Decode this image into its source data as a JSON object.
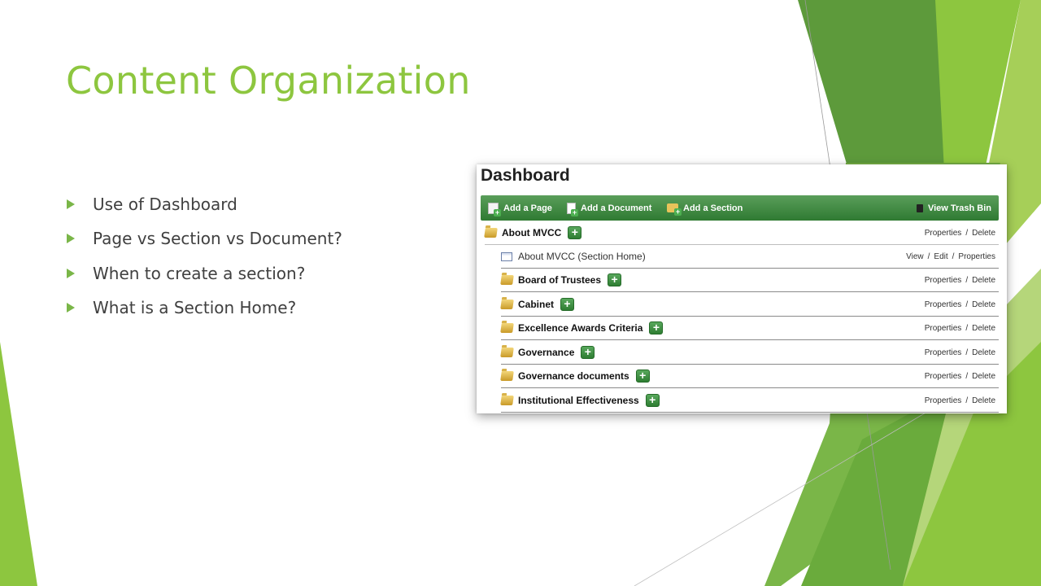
{
  "slide": {
    "title": "Content Organization",
    "bullets": [
      "Use of Dashboard",
      "Page vs Section vs Document?",
      "When to create a section?",
      "What is a Section Home?"
    ]
  },
  "colors": {
    "title_green": "#8dc63f",
    "toolbar_green": "#3d8a40",
    "accent_dark_green": "#5d9a3b"
  },
  "dashboard": {
    "title": "Dashboard",
    "toolbar": {
      "add_page": "Add a Page",
      "add_document": "Add a Document",
      "add_section": "Add a Section",
      "view_trash": "View Trash Bin"
    },
    "add_symbol": "+",
    "rows": [
      {
        "label": "About MVCC",
        "actions": [
          "Properties",
          "Delete"
        ]
      },
      {
        "label": "About MVCC (Section Home)",
        "actions": [
          "View",
          "Edit",
          "Properties"
        ]
      },
      {
        "label": "Board of Trustees",
        "actions": [
          "Properties",
          "Delete"
        ]
      },
      {
        "label": "Cabinet",
        "actions": [
          "Properties",
          "Delete"
        ]
      },
      {
        "label": "Excellence Awards Criteria",
        "actions": [
          "Properties",
          "Delete"
        ]
      },
      {
        "label": "Governance",
        "actions": [
          "Properties",
          "Delete"
        ]
      },
      {
        "label": "Governance documents",
        "actions": [
          "Properties",
          "Delete"
        ]
      },
      {
        "label": "Institutional Effectiveness",
        "actions": [
          "Properties",
          "Delete"
        ]
      }
    ],
    "separator": "/"
  }
}
